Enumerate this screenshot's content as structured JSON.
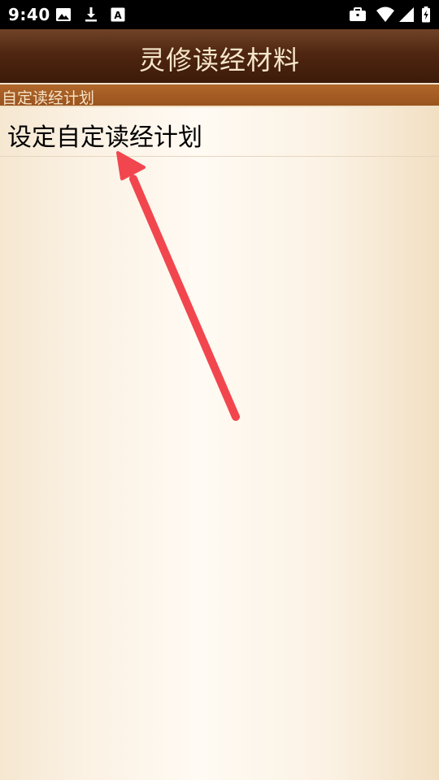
{
  "status_bar": {
    "time": "9:40",
    "icons": [
      "image-icon",
      "download-icon",
      "a-box-icon",
      "briefcase-icon",
      "wifi-icon",
      "signal-icon",
      "battery-charging-icon"
    ]
  },
  "header": {
    "title": "灵修读经材料"
  },
  "section": {
    "title": "自定读经计划"
  },
  "list": {
    "items": [
      {
        "label": "设定自定读经计划"
      }
    ]
  },
  "annotation": {
    "arrow_color": "#f2464f"
  },
  "colors": {
    "title_bar": "#4f2611",
    "section_bar": "#a35a22",
    "background": "#fdf6ec"
  }
}
